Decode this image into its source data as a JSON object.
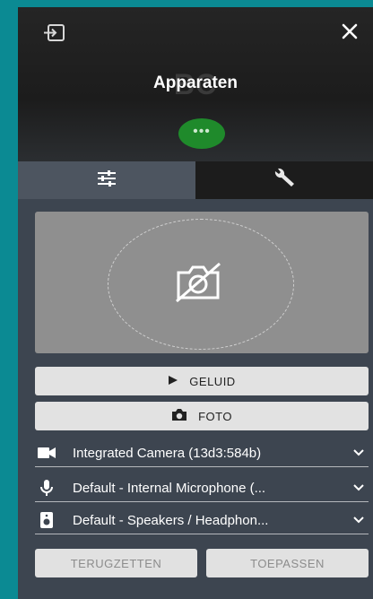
{
  "header": {
    "title": "Apparaten",
    "avatar_initials": "BC",
    "status_dots": "•••",
    "exit_icon": "exit-icon",
    "close_icon": "close-icon"
  },
  "tabs": [
    {
      "icon": "sliders-icon",
      "active": true
    },
    {
      "icon": "wrench-icon",
      "active": false
    }
  ],
  "preview": {
    "icon": "camera-off-icon"
  },
  "buttons": {
    "sound_label": "GELUID",
    "photo_label": "FOTO"
  },
  "devices": {
    "camera": "Integrated Camera (13d3:584b)",
    "microphone": "Default - Internal Microphone (...",
    "speakers": "Default - Speakers / Headphon..."
  },
  "footer": {
    "reset_label": "TERUGZETTEN",
    "apply_label": "TOEPASSEN"
  },
  "colors": {
    "background": "#0b8a93",
    "panel": "#3d4550",
    "status": "#1f8a2b"
  }
}
